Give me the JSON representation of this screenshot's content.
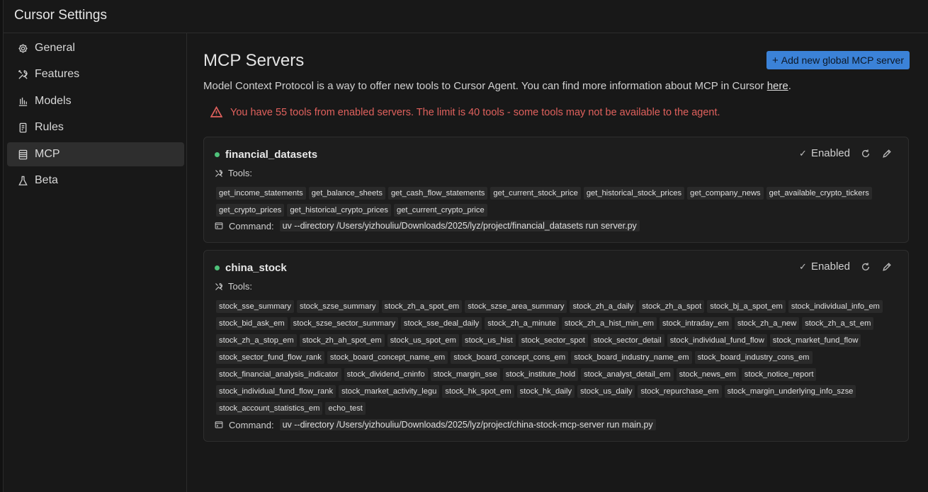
{
  "window": {
    "title": "Cursor Settings"
  },
  "sidebar": {
    "items": [
      {
        "label": "General",
        "icon": "gear-icon",
        "active": false
      },
      {
        "label": "Features",
        "icon": "tools-icon",
        "active": false
      },
      {
        "label": "Models",
        "icon": "bar-chart-icon",
        "active": false
      },
      {
        "label": "Rules",
        "icon": "document-icon",
        "active": false
      },
      {
        "label": "MCP",
        "icon": "server-icon",
        "active": true
      },
      {
        "label": "Beta",
        "icon": "flask-icon",
        "active": false
      }
    ]
  },
  "main": {
    "title": "MCP Servers",
    "add_button": "Add new global MCP server",
    "description": "Model Context Protocol is a way to offer new tools to Cursor Agent. You can find more information about MCP in Cursor ",
    "description_link": "here",
    "description_end": ".",
    "warning": "You have 55 tools from enabled servers. The limit is 40 tools - some tools may not be available to the agent.",
    "tools_label": "Tools:",
    "command_label": "Command:",
    "enabled_label": "Enabled",
    "servers": [
      {
        "name": "financial_datasets",
        "status_color": "#4fc27a",
        "tools": [
          "get_income_statements",
          "get_balance_sheets",
          "get_cash_flow_statements",
          "get_current_stock_price",
          "get_historical_stock_prices",
          "get_company_news",
          "get_available_crypto_tickers",
          "get_crypto_prices",
          "get_historical_crypto_prices",
          "get_current_crypto_price"
        ],
        "command": "uv --directory /Users/yizhouliu/Downloads/2025/lyz/project/financial_datasets run server.py"
      },
      {
        "name": "china_stock",
        "status_color": "#4fc27a",
        "tools": [
          "stock_sse_summary",
          "stock_szse_summary",
          "stock_zh_a_spot_em",
          "stock_szse_area_summary",
          "stock_zh_a_daily",
          "stock_zh_a_spot",
          "stock_bj_a_spot_em",
          "stock_individual_info_em",
          "stock_bid_ask_em",
          "stock_szse_sector_summary",
          "stock_sse_deal_daily",
          "stock_zh_a_minute",
          "stock_zh_a_hist_min_em",
          "stock_intraday_em",
          "stock_zh_a_new",
          "stock_zh_a_st_em",
          "stock_zh_a_stop_em",
          "stock_zh_ah_spot_em",
          "stock_us_spot_em",
          "stock_us_hist",
          "stock_sector_spot",
          "stock_sector_detail",
          "stock_individual_fund_flow",
          "stock_market_fund_flow",
          "stock_sector_fund_flow_rank",
          "stock_board_concept_name_em",
          "stock_board_concept_cons_em",
          "stock_board_industry_name_em",
          "stock_board_industry_cons_em",
          "stock_financial_analysis_indicator",
          "stock_dividend_cninfo",
          "stock_margin_sse",
          "stock_institute_hold",
          "stock_analyst_detail_em",
          "stock_news_em",
          "stock_notice_report",
          "stock_individual_fund_flow_rank",
          "stock_market_activity_legu",
          "stock_hk_spot_em",
          "stock_hk_daily",
          "stock_us_daily",
          "stock_repurchase_em",
          "stock_margin_underlying_info_szse",
          "stock_account_statistics_em",
          "echo_test"
        ],
        "command": "uv --directory /Users/yizhouliu/Downloads/2025/lyz/project/china-stock-mcp-server run main.py"
      }
    ]
  }
}
